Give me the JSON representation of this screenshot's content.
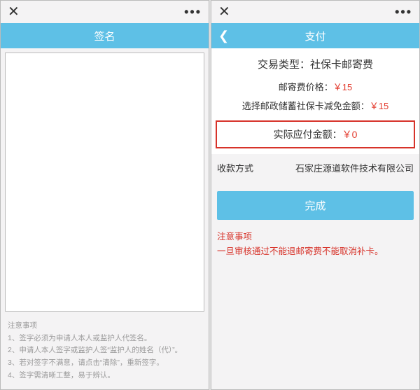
{
  "left": {
    "title": "签名",
    "notes_header": "注意事项",
    "notes": [
      "1、签字必须为申请人本人或监护人代签名。",
      "2、申请人本人签字或监护人签“监护人的姓名（代）”。",
      "3、若对签字不满意，请点击“清除”，重新签字。",
      "4、签字需清晰工整，易于辨认。"
    ]
  },
  "right": {
    "title": "支付",
    "tx_type_label": "交易类型：",
    "tx_type_value": "社保卡邮寄费",
    "mail_fee_label": "邮寄费价格：",
    "mail_fee_value": "￥15",
    "discount_label": "选择邮政储蓄社保卡减免金额：",
    "discount_value": "￥15",
    "actual_label": "实际应付金额：",
    "actual_value": "￥0",
    "payee_label": "收款方式",
    "payee_value": "石家庄源道软件技术有限公司",
    "done": "完成",
    "warn_header": "注意事项",
    "warn_text": "一旦审核通过不能退邮寄费不能取消补卡。"
  }
}
